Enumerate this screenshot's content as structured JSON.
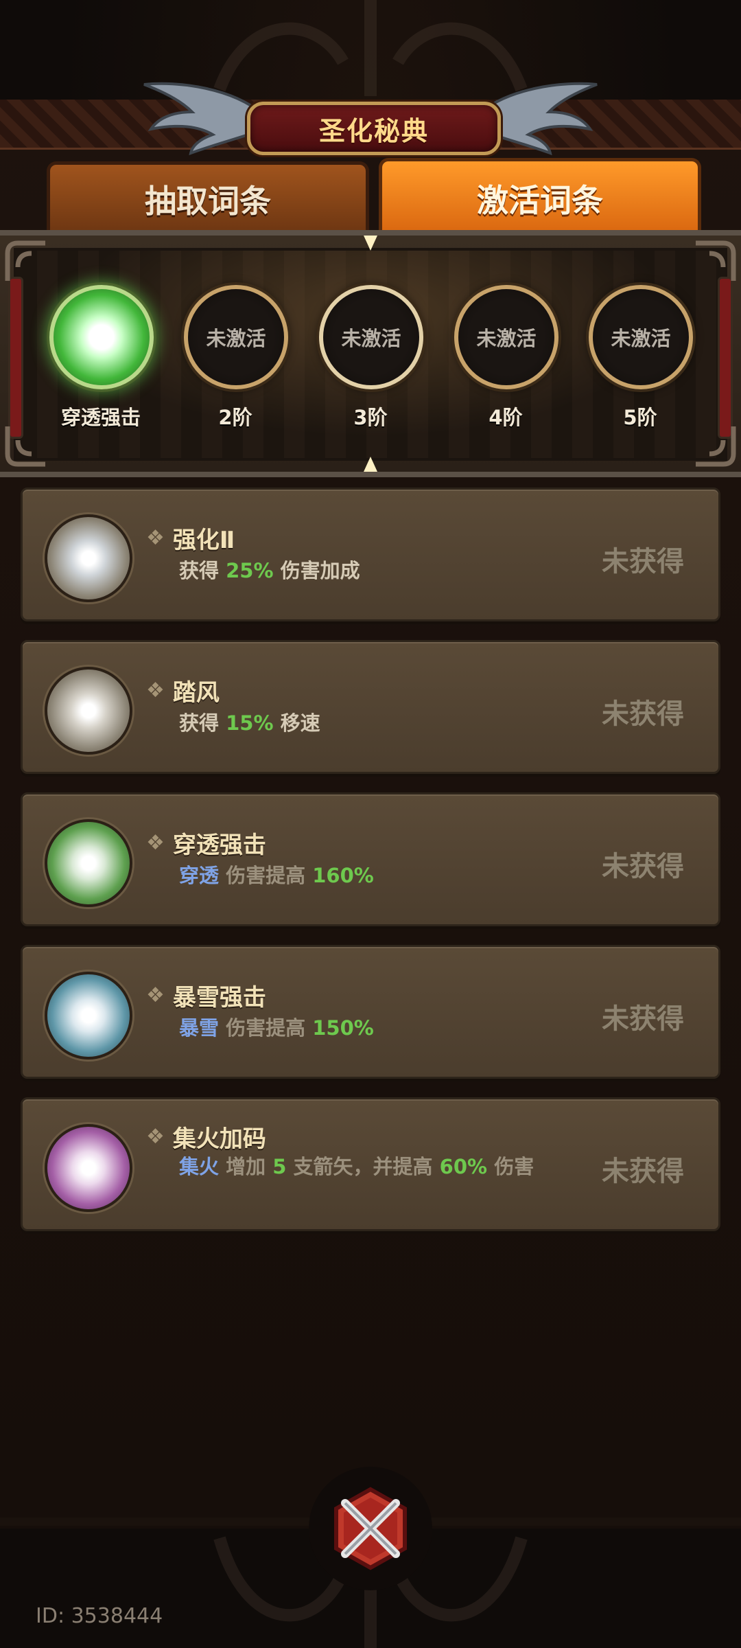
{
  "header": {
    "title": "圣化秘典"
  },
  "tabs": [
    {
      "label": "抽取词条",
      "active": false
    },
    {
      "label": "激活词条",
      "active": true
    }
  ],
  "tiers": [
    {
      "label": "穿透强击",
      "medal_text": "",
      "active": true
    },
    {
      "label": "2阶",
      "medal_text": "未激活",
      "active": false
    },
    {
      "label": "3阶",
      "medal_text": "未激活",
      "active": false
    },
    {
      "label": "4阶",
      "medal_text": "未激活",
      "active": false
    },
    {
      "label": "5阶",
      "medal_text": "未激活",
      "active": false
    }
  ],
  "entries": [
    {
      "name": "强化Ⅱ",
      "desc": [
        "获得",
        "25%",
        "伤害加成"
      ],
      "status": "未获得",
      "orb": "grey"
    },
    {
      "name": "踏风",
      "desc": [
        "获得",
        "15%",
        "移速"
      ],
      "status": "未获得",
      "orb": "grey"
    },
    {
      "name": "穿透强击",
      "desc": [
        "穿透",
        "伤害提高",
        "160%"
      ],
      "status": "未获得",
      "orb": "green"
    },
    {
      "name": "暴雪强击",
      "desc": [
        "暴雪",
        "伤害提高",
        "150%"
      ],
      "status": "未获得",
      "orb": "blue"
    },
    {
      "name": "集火加码",
      "desc": [
        "集火",
        "增加",
        "5",
        "支箭矢，并提高",
        "60%",
        "伤害"
      ],
      "status": "未获得",
      "orb": "purple"
    }
  ],
  "footer": {
    "id_text": "ID: 3538444"
  },
  "colors": {
    "accent_orange": "#ff9a2a",
    "highlight_green": "#6ec94e",
    "keyword_blue": "#7fa3e6",
    "title_gold": "#ffd98a"
  },
  "icons": {
    "close": "crossed-swords-icon",
    "bullet": "diamond-icon"
  }
}
